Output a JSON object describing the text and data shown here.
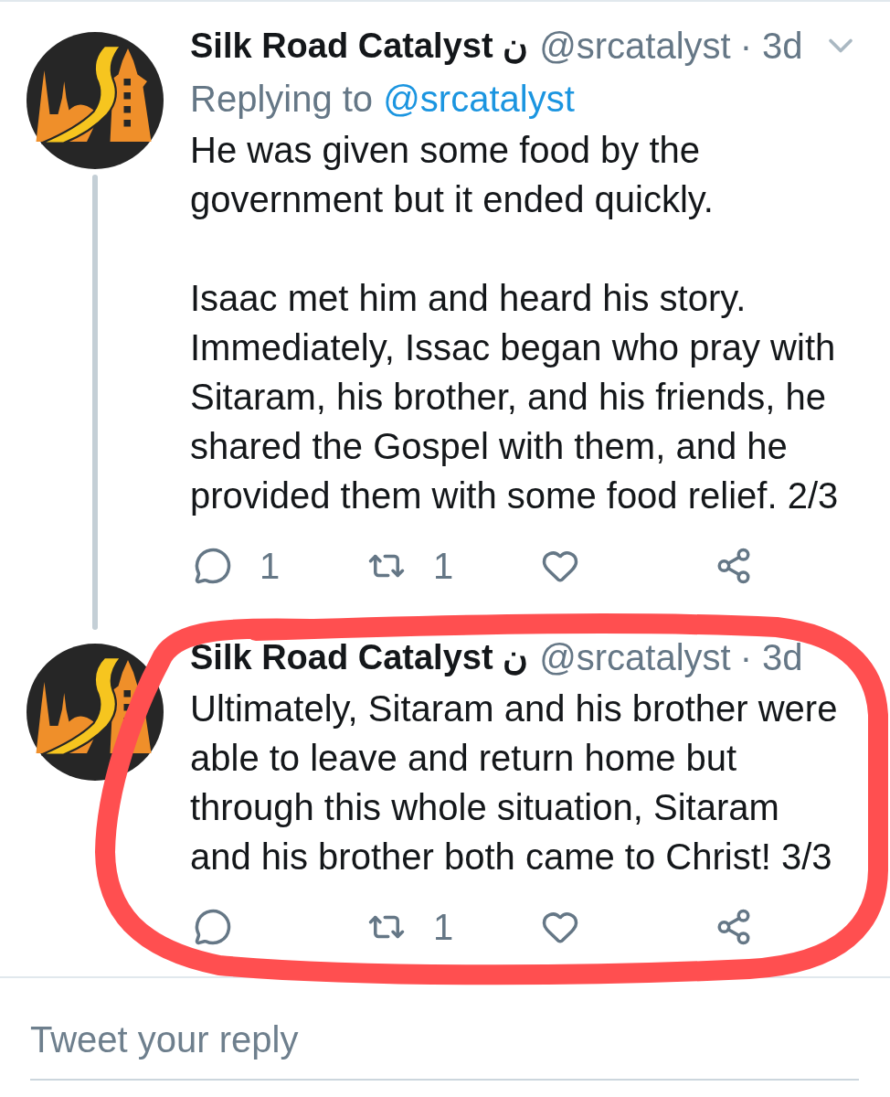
{
  "tweets": [
    {
      "author": {
        "name": "Silk Road Catalyst ن",
        "handle": "@srcatalyst",
        "time": "· 3d"
      },
      "menu": true,
      "thread_line": true,
      "replying_to": {
        "label": "Replying to",
        "handle": "@srcatalyst"
      },
      "paragraphs": [
        "He was given some food by the\ngovernment but it ended quickly.",
        "Isaac met him and heard his story.\nImmediately, Issac began who pray with\nSitaram, his brother, and his friends, he\nshared the Gospel with them, and he\nprovided them with some food relief. 2/3"
      ],
      "actions": [
        {
          "kind": "reply",
          "count": "1"
        },
        {
          "kind": "retweet",
          "count": "1"
        },
        {
          "kind": "like"
        },
        {
          "kind": "share"
        }
      ]
    },
    {
      "author": {
        "name": "Silk Road Catalyst ن",
        "handle": "@srcatalyst",
        "time": "· 3d"
      },
      "menu": false,
      "thread_line": false,
      "paragraphs": [
        "Ultimately, Sitaram and his brother were\nable to leave and return home but\nthrough this whole situation, Sitaram\nand his brother both came to Christ! 3/3"
      ],
      "actions": [
        {
          "kind": "reply"
        },
        {
          "kind": "retweet",
          "count": "1"
        },
        {
          "kind": "like"
        },
        {
          "kind": "share"
        }
      ]
    }
  ],
  "reply_box": {
    "placeholder": "Tweet your reply"
  },
  "annotation": {
    "kind": "loop"
  }
}
